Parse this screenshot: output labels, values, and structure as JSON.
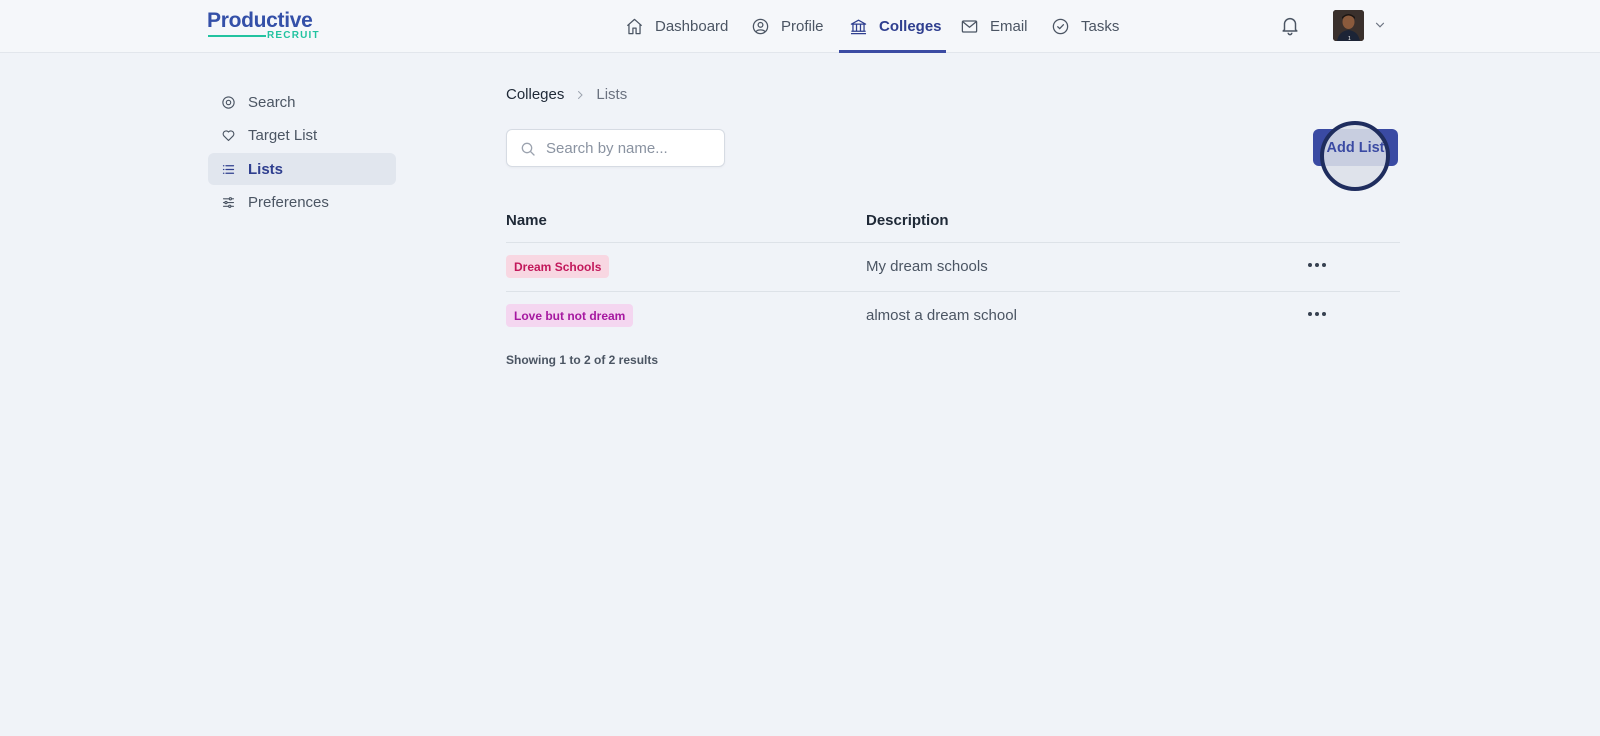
{
  "brand": {
    "name": "Productive",
    "sub": "RECRUIT"
  },
  "nav": {
    "items": [
      {
        "label": "Dashboard",
        "icon": "home-icon"
      },
      {
        "label": "Profile",
        "icon": "user-circle-icon"
      },
      {
        "label": "Colleges",
        "icon": "building-columns-icon",
        "active": true
      },
      {
        "label": "Email",
        "icon": "envelope-icon"
      },
      {
        "label": "Tasks",
        "icon": "check-circle-icon"
      }
    ],
    "accent": "#3b4ba3"
  },
  "header": {
    "notifications_icon": "bell-icon",
    "avatar_label": "1",
    "avatar_menu_icon": "chevron-down-icon"
  },
  "sidebar": {
    "items": [
      {
        "label": "Search",
        "icon": "at-circle-icon"
      },
      {
        "label": "Target List",
        "icon": "heart-icon"
      },
      {
        "label": "Lists",
        "icon": "list-icon",
        "active": true
      },
      {
        "label": "Preferences",
        "icon": "sliders-icon"
      }
    ]
  },
  "breadcrumb": {
    "items": [
      "Colleges",
      "Lists"
    ]
  },
  "search": {
    "placeholder": "Search by name...",
    "value": ""
  },
  "actions": {
    "add_list_label": "Add List"
  },
  "table": {
    "columns": [
      "Name",
      "Description"
    ],
    "rows": [
      {
        "name": "Dream Schools",
        "description": "My dream schools",
        "tag_color": "#c2185b",
        "tag_bg": "#f8d7e2"
      },
      {
        "name": "Love but not dream",
        "description": "almost a dream school",
        "tag_color": "#a618a0",
        "tag_bg": "#f4d6f0"
      }
    ],
    "row_menu_icon": "ellipsis-horizontal-icon"
  },
  "pagination": {
    "summary": "Showing 1 to 2 of 2 results"
  }
}
